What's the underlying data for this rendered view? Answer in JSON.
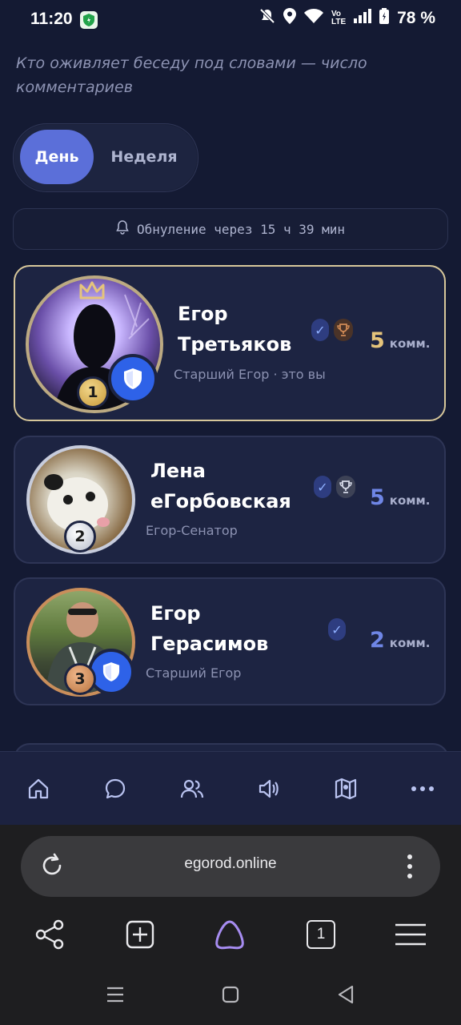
{
  "status": {
    "time": "11:20",
    "battery": "78 %"
  },
  "subtitle": "Кто оживляет беседу под словами — число комментариев",
  "tabs": {
    "day": "День",
    "week": "Неделя"
  },
  "reset": {
    "text": "Обнуление через 15 ч 39 мин"
  },
  "leaders": [
    {
      "rank": "1",
      "name_line1": "Егор",
      "name_line2": "Третьяков",
      "role": "Старший Егор · это вы",
      "score": "5",
      "unit": "комм."
    },
    {
      "rank": "2",
      "name_line1": "Лена",
      "name_line2": "еГорбовская",
      "role": "Егор-Сенатор",
      "score": "5",
      "unit": "комм."
    },
    {
      "rank": "3",
      "name_line1": "Егор",
      "name_line2": "Герасимов",
      "role": "Старший Егор",
      "score": "2",
      "unit": "комм."
    }
  ],
  "colors": {
    "gold": "#e5c47b",
    "silver": "#cfd4e6",
    "bronze": "#c98e5b",
    "accent": "#5b6fd9",
    "score_blue": "#6f86e6"
  },
  "browser": {
    "url": "egorod.online",
    "tab_count": "1"
  }
}
